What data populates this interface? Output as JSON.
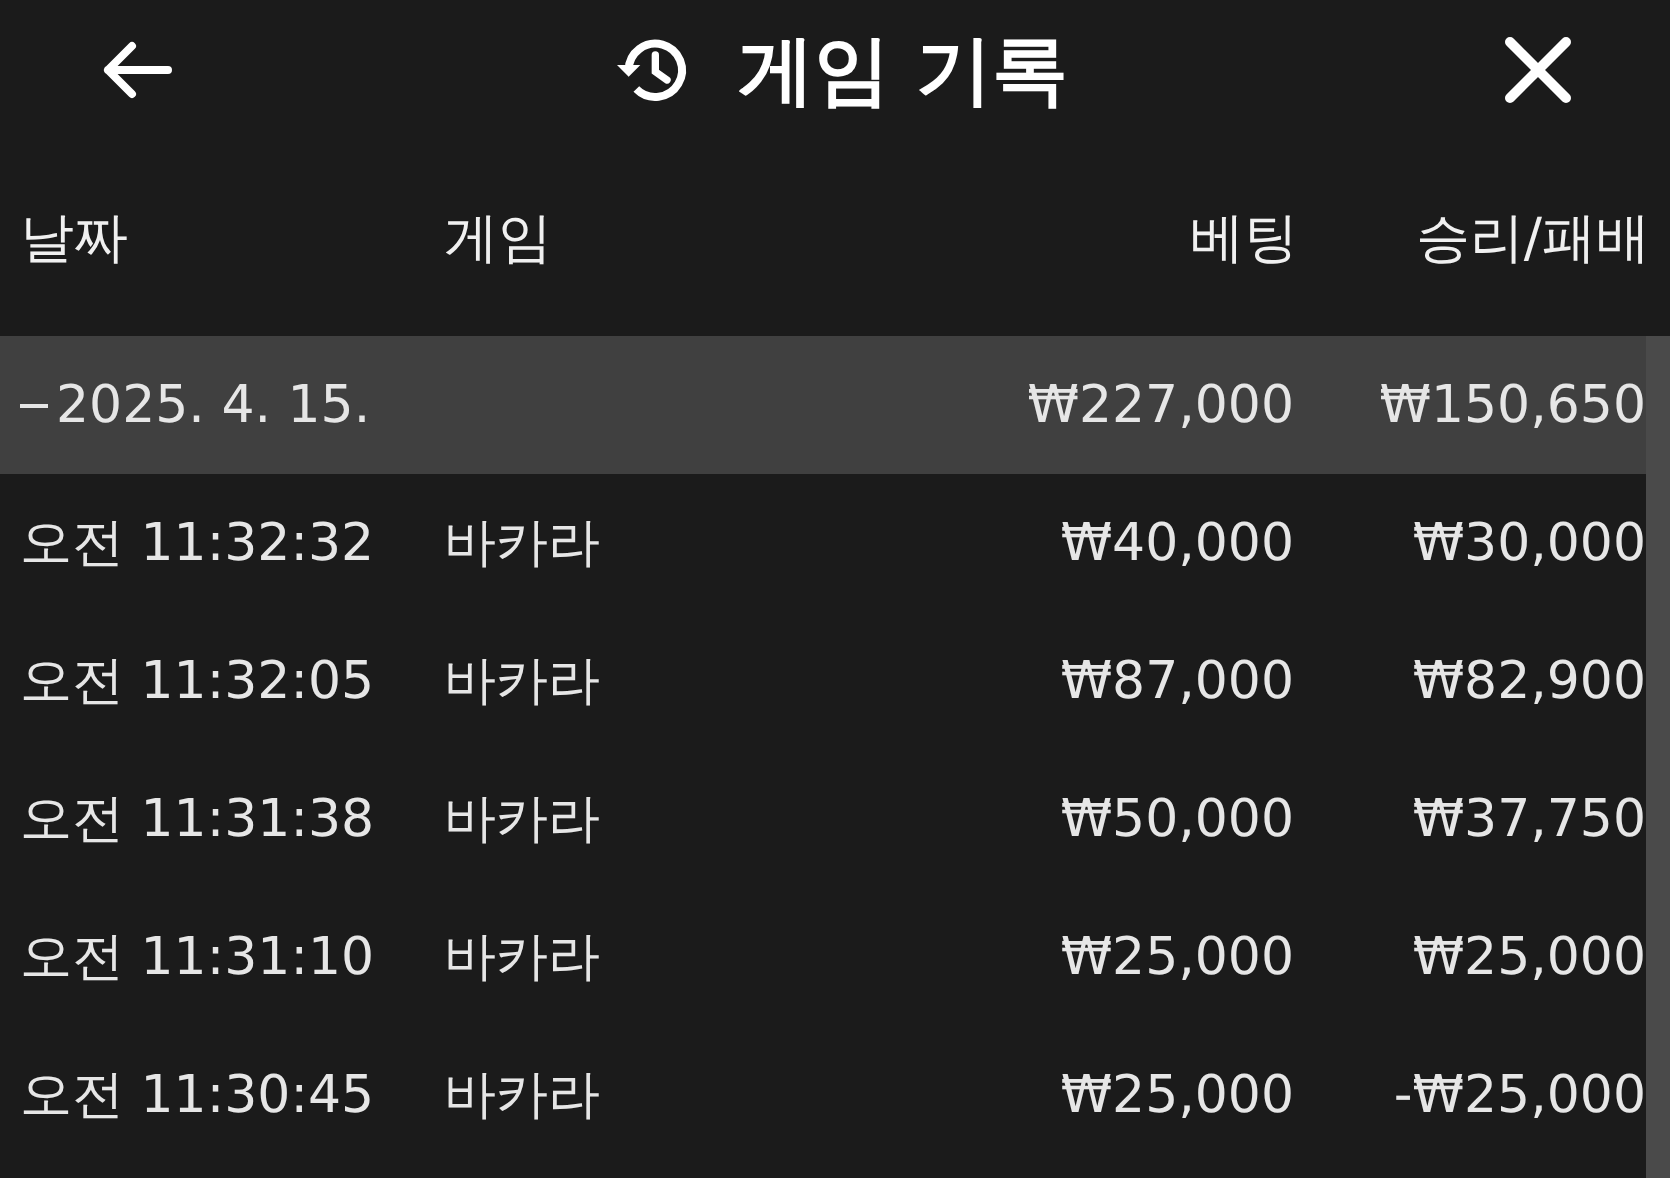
{
  "header": {
    "title": "게임 기록"
  },
  "columns": [
    "날짜",
    "게임",
    "베팅",
    "승리/패배"
  ],
  "group": {
    "date": "2025. 4. 15.",
    "expanded": true,
    "bet": "₩227,000",
    "result": "₩150,650"
  },
  "rows": [
    {
      "time": "오전 11:32:32",
      "game": "바카라",
      "bet": "₩40,000",
      "result": "₩30,000"
    },
    {
      "time": "오전 11:32:05",
      "game": "바카라",
      "bet": "₩87,000",
      "result": "₩82,900"
    },
    {
      "time": "오전 11:31:38",
      "game": "바카라",
      "bet": "₩50,000",
      "result": "₩37,750"
    },
    {
      "time": "오전 11:31:10",
      "game": "바카라",
      "bet": "₩25,000",
      "result": "₩25,000"
    },
    {
      "time": "오전 11:30:45",
      "game": "바카라",
      "bet": "₩25,000",
      "result": "-₩25,000"
    }
  ]
}
